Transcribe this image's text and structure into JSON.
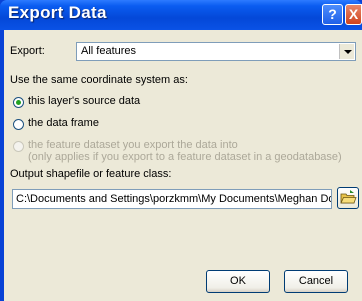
{
  "window": {
    "title": "Export Data",
    "help_label": "?",
    "close_label": "X"
  },
  "export": {
    "label": "Export:",
    "selected": "All features"
  },
  "coordinate_system": {
    "heading": "Use the same coordinate system as:",
    "options": [
      {
        "label": "this layer's source data",
        "checked": true,
        "enabled": true
      },
      {
        "label": "the data frame",
        "checked": false,
        "enabled": true
      },
      {
        "label": "the feature dataset you export the data into",
        "sublabel": "(only applies if you export to a feature dataset in a geodatabase)",
        "checked": false,
        "enabled": false
      }
    ]
  },
  "output": {
    "label": "Output shapefile or feature class:",
    "value": "C:\\Documents and Settings\\porzkmm\\My Documents\\Meghan Docu",
    "browse_icon": "open-folder-icon"
  },
  "buttons": {
    "ok": "OK",
    "cancel": "Cancel"
  },
  "colors": {
    "titlebar": "#0a52e6",
    "dialog_bg": "#ece9d8",
    "radio_checked": "#21a121"
  }
}
